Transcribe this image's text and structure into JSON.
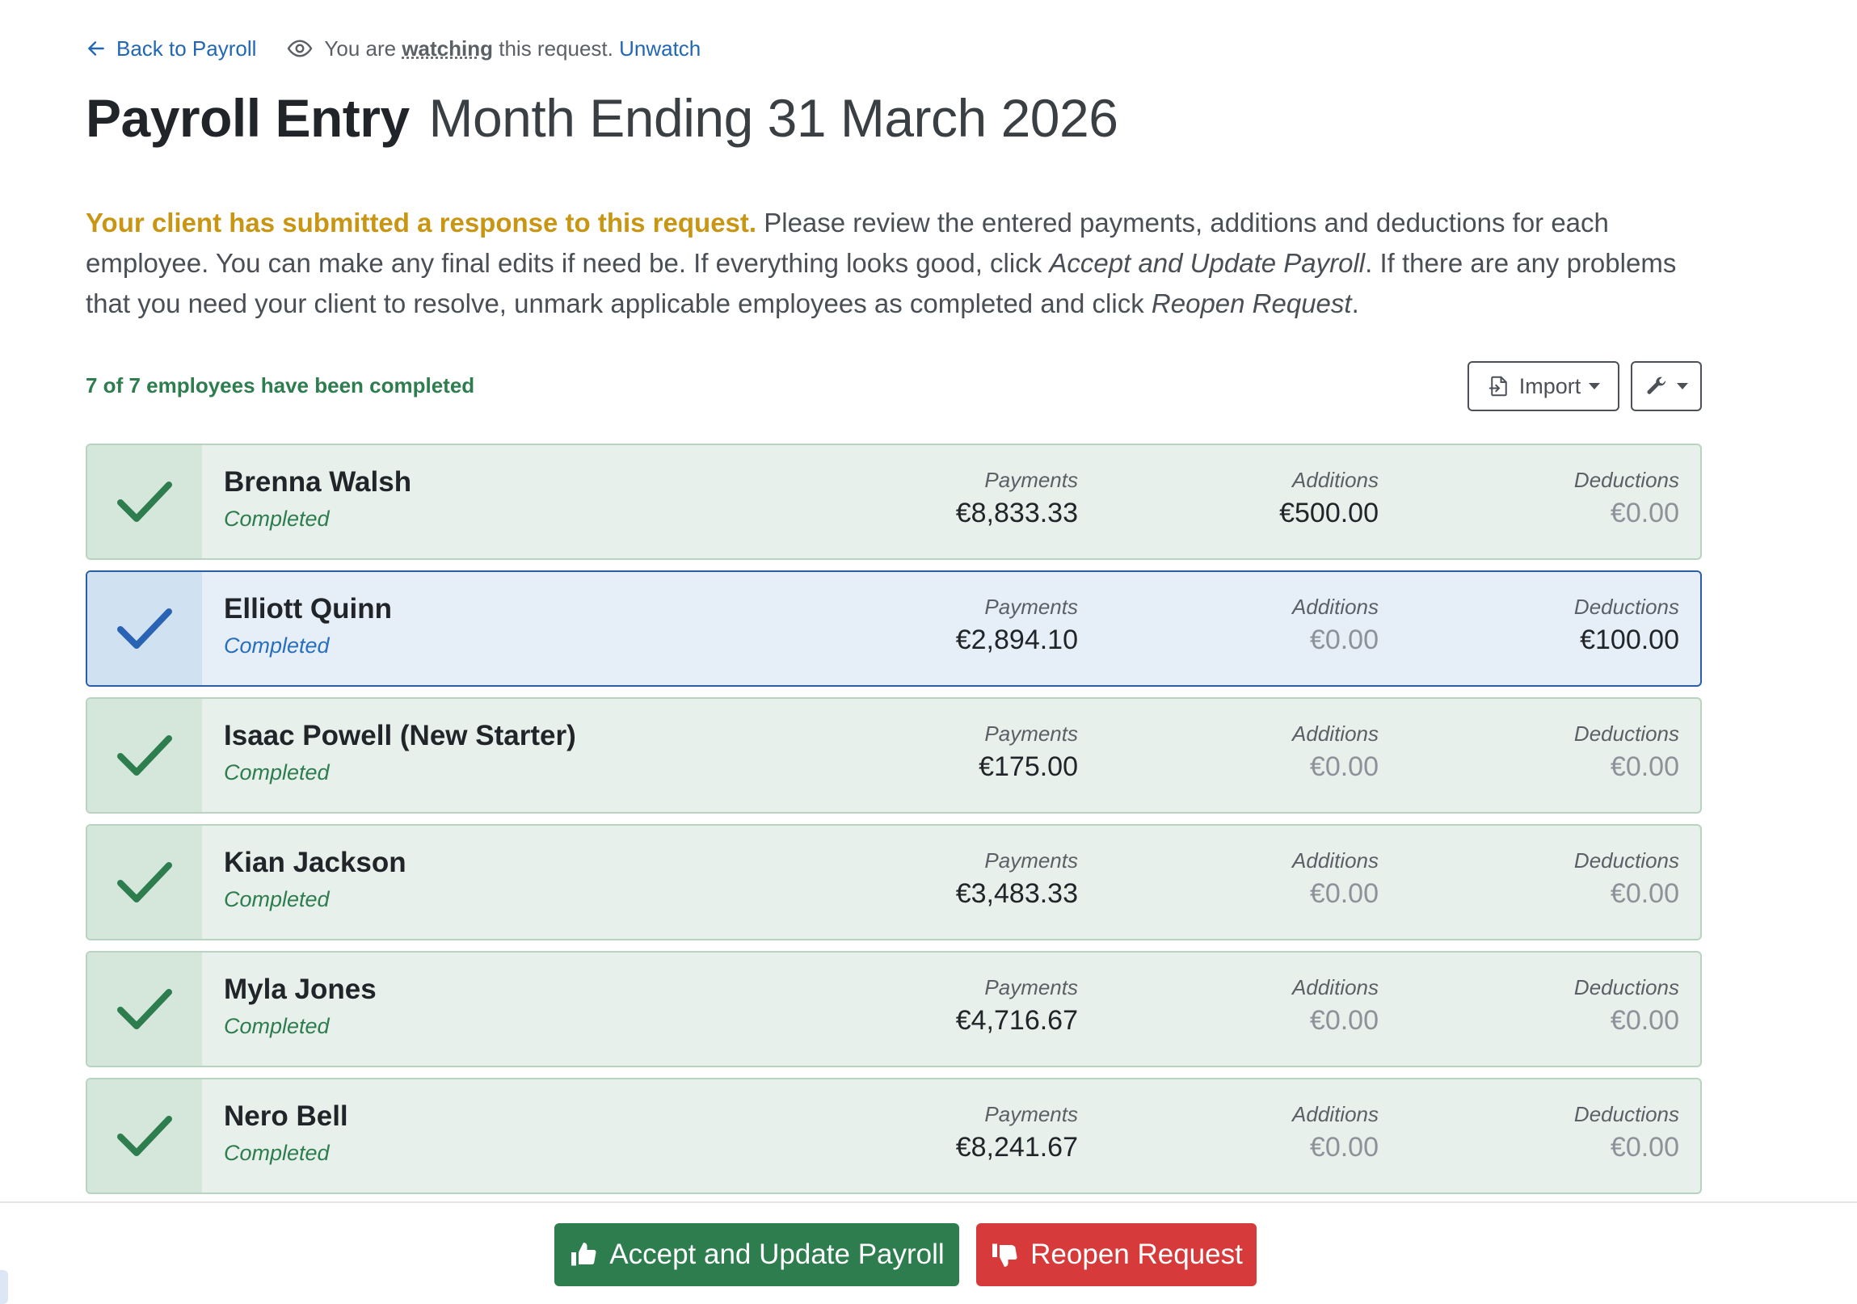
{
  "nav": {
    "back_label": "Back to Payroll",
    "watch_prefix": "You are",
    "watch_word": "watching",
    "watch_suffix": "this request.",
    "unwatch_label": "Unwatch"
  },
  "page": {
    "title_strong": "Payroll Entry",
    "title_light": "Month Ending 31 March 2026"
  },
  "intro": {
    "alert": "Your client has submitted a response to this request.",
    "text_1": "Please review the entered payments, additions and deductions for each employee. You can make any final edits if need be. If everything looks good, click",
    "accept_ref": "Accept and Update Payroll",
    "text_2": ". If there are any problems that you need your client to resolve, unmark applicable employees as completed and click",
    "reopen_ref": "Reopen Request",
    "text_3": "."
  },
  "summary": "7 of 7 employees have been completed",
  "toolbar": {
    "import_label": "Import",
    "import_icon": "file-import-icon",
    "tools_icon": "wrench-icon"
  },
  "labels": {
    "payments": "Payments",
    "additions": "Additions",
    "deductions": "Deductions"
  },
  "employees": [
    {
      "name": "Brenna Walsh",
      "status": "Completed",
      "payments": "€8,833.33",
      "additions": "€500.00",
      "deductions": "€0.00",
      "active": false
    },
    {
      "name": "Elliott Quinn",
      "status": "Completed",
      "payments": "€2,894.10",
      "additions": "€0.00",
      "deductions": "€100.00",
      "active": true
    },
    {
      "name": "Isaac Powell (New Starter)",
      "status": "Completed",
      "payments": "€175.00",
      "additions": "€0.00",
      "deductions": "€0.00",
      "active": false
    },
    {
      "name": "Kian Jackson",
      "status": "Completed",
      "payments": "€3,483.33",
      "additions": "€0.00",
      "deductions": "€0.00",
      "active": false
    },
    {
      "name": "Myla Jones",
      "status": "Completed",
      "payments": "€4,716.67",
      "additions": "€0.00",
      "deductions": "€0.00",
      "active": false
    },
    {
      "name": "Nero Bell",
      "status": "Completed",
      "payments": "€8,241.67",
      "additions": "€0.00",
      "deductions": "€0.00",
      "active": false
    }
  ],
  "actions": {
    "accept_label": "Accept and Update Payroll",
    "reopen_label": "Reopen Request",
    "accept_icon": "thumbs-up-icon",
    "reopen_icon": "thumbs-down-icon"
  },
  "colors": {
    "success": "#2e7d4f",
    "danger": "#d63a3a",
    "link": "#2167b5",
    "warning": "#c99613",
    "active_row": "#2a5fa8"
  }
}
